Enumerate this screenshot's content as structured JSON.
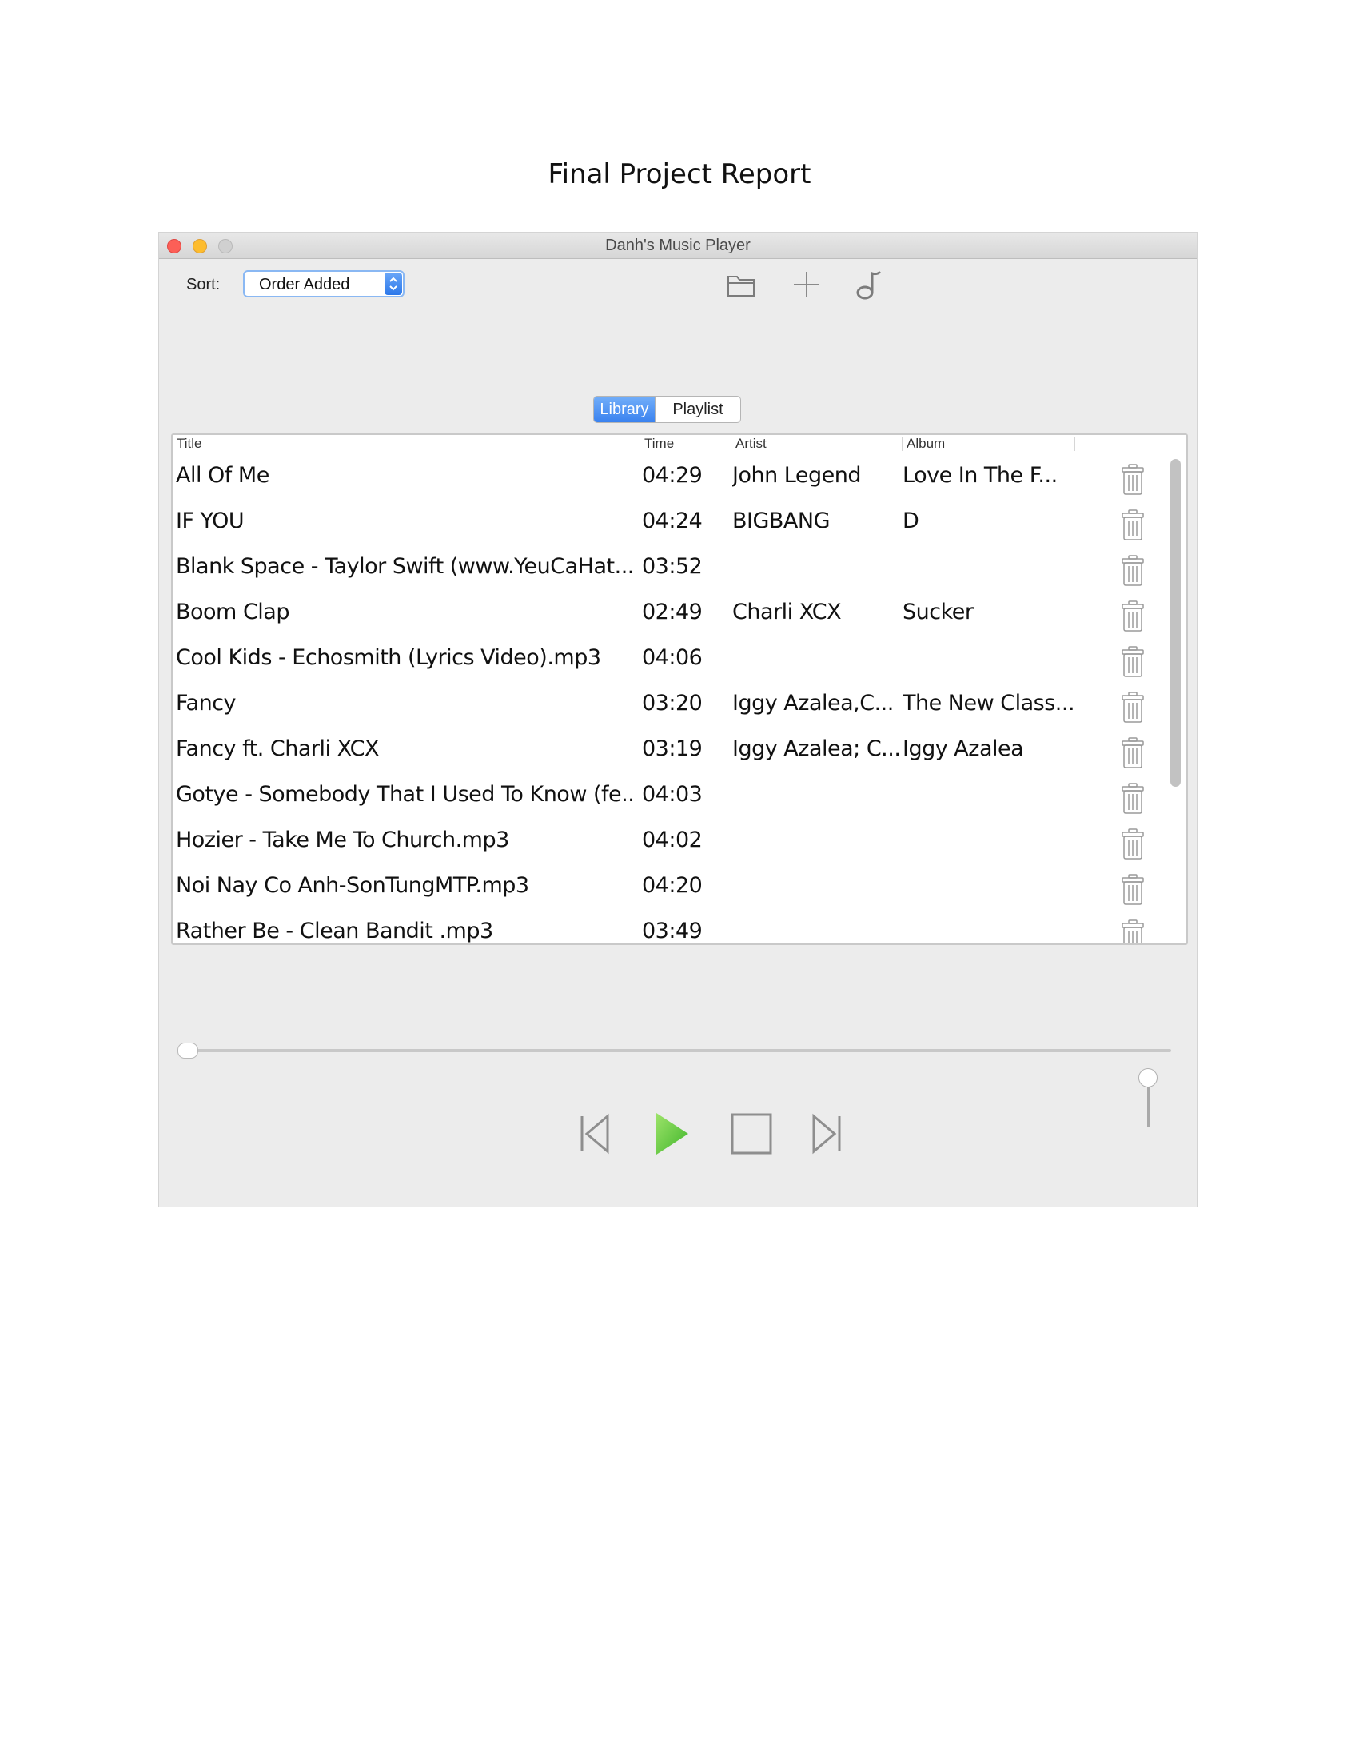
{
  "document": {
    "title": "Final Project Report"
  },
  "window": {
    "title": "Danh's Music Player"
  },
  "toolbar": {
    "sort_label": "Sort:",
    "sort_value": "Order Added",
    "icons": [
      "folder-icon",
      "plus-icon",
      "music-note-icon"
    ]
  },
  "tabs": [
    {
      "label": "Library",
      "active": true
    },
    {
      "label": "Playlist",
      "active": false
    }
  ],
  "table": {
    "columns": [
      "Title",
      "Time",
      "Artist",
      "Album"
    ],
    "rows": [
      {
        "title": "All Of Me",
        "time": "04:29",
        "artist": "John Legend",
        "album": "Love In The F..."
      },
      {
        "title": "IF YOU",
        "time": "04:24",
        "artist": "BIGBANG",
        "album": "D"
      },
      {
        "title": "Blank Space - Taylor Swift (www.YeuCaHat....",
        "time": "03:52",
        "artist": "",
        "album": ""
      },
      {
        "title": "Boom Clap",
        "time": "02:49",
        "artist": "Charli XCX",
        "album": "Sucker"
      },
      {
        "title": "Cool Kids - Echosmith (Lyrics Video).mp3",
        "time": "04:06",
        "artist": "",
        "album": ""
      },
      {
        "title": "Fancy",
        "time": "03:20",
        "artist": "Iggy Azalea,C...",
        "album": "The New Class..."
      },
      {
        "title": "Fancy ft. Charli XCX",
        "time": "03:19",
        "artist": "Iggy Azalea; C...",
        "album": "Iggy Azalea"
      },
      {
        "title": "Gotye - Somebody That I Used To Know (fe...",
        "time": "04:03",
        "artist": "",
        "album": ""
      },
      {
        "title": "Hozier - Take Me To Church.mp3",
        "time": "04:02",
        "artist": "",
        "album": ""
      },
      {
        "title": "Noi Nay Co Anh-SonTungMTP.mp3",
        "time": "04:20",
        "artist": "",
        "album": ""
      },
      {
        "title": "Rather Be - Clean Bandit .mp3",
        "time": "03:49",
        "artist": "",
        "album": ""
      }
    ]
  },
  "player": {
    "seek_position": 0,
    "volume_level": 1,
    "controls": [
      "previous-icon",
      "play-icon",
      "stop-icon",
      "next-icon"
    ],
    "play_color": "#5fcf3a"
  },
  "colors": {
    "accent": "#3a82ef",
    "window_bg": "#ececec"
  }
}
